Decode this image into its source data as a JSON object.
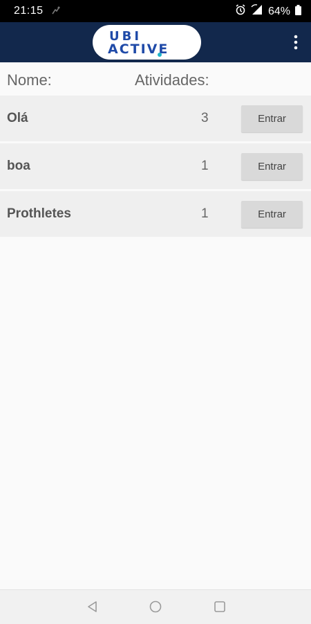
{
  "status_bar": {
    "time": "21:15",
    "battery_text": "64%",
    "icons": [
      "notification-icon",
      "alarm-icon",
      "signal-icon",
      "battery-icon"
    ]
  },
  "app_bar": {
    "logo_line1": "UBI",
    "logo_line2": "ACTIVE",
    "logo_color": "#1f4aa8",
    "logo_accent": "#1fb5c9",
    "background": "#12284c",
    "overflow_icon": "more-vert-icon"
  },
  "table": {
    "headers": {
      "name": "Nome:",
      "activities": "Atividades:"
    },
    "rows": [
      {
        "name": "Olá",
        "count": "3",
        "button": "Entrar"
      },
      {
        "name": "boa",
        "count": "1",
        "button": "Entrar"
      },
      {
        "name": "Prothletes",
        "count": "1",
        "button": "Entrar"
      }
    ]
  },
  "nav_bar": {
    "icons": [
      "back-icon",
      "home-icon",
      "recents-icon"
    ]
  }
}
